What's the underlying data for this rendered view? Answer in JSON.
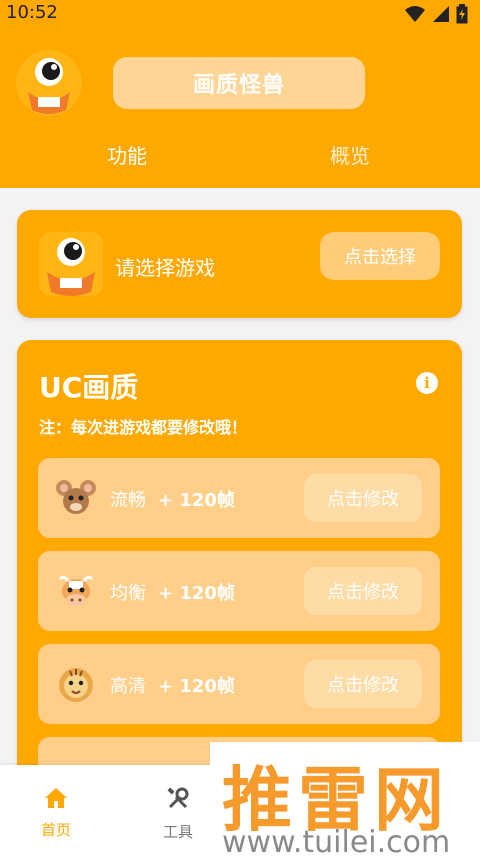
{
  "status": {
    "time": "10:52"
  },
  "header": {
    "title": "画质怪兽",
    "tabs": [
      "功能",
      "概览"
    ],
    "colors": {
      "primary": "#FFA800",
      "pill": "#FFD596"
    }
  },
  "game_select": {
    "prompt": "请选择游戏",
    "button": "点击选择"
  },
  "uc": {
    "title": "UC画质",
    "note": "注：每次进游戏都要修改哦！",
    "rows": [
      {
        "icon": "mouse-icon",
        "name": "流畅",
        "frames": "+ 120帧",
        "button": "点击修改"
      },
      {
        "icon": "cow-icon",
        "name": "均衡",
        "frames": "+ 120帧",
        "button": "点击修改"
      },
      {
        "icon": "tiger-icon",
        "name": "高清",
        "frames": "+ 120帧",
        "button": "点击修改"
      }
    ]
  },
  "bottom_nav": [
    {
      "icon": "home-icon",
      "label": "首页"
    },
    {
      "icon": "tools-icon",
      "label": "工具"
    }
  ],
  "watermark": {
    "text": "推雷网",
    "url": "www.tuilei.com"
  }
}
